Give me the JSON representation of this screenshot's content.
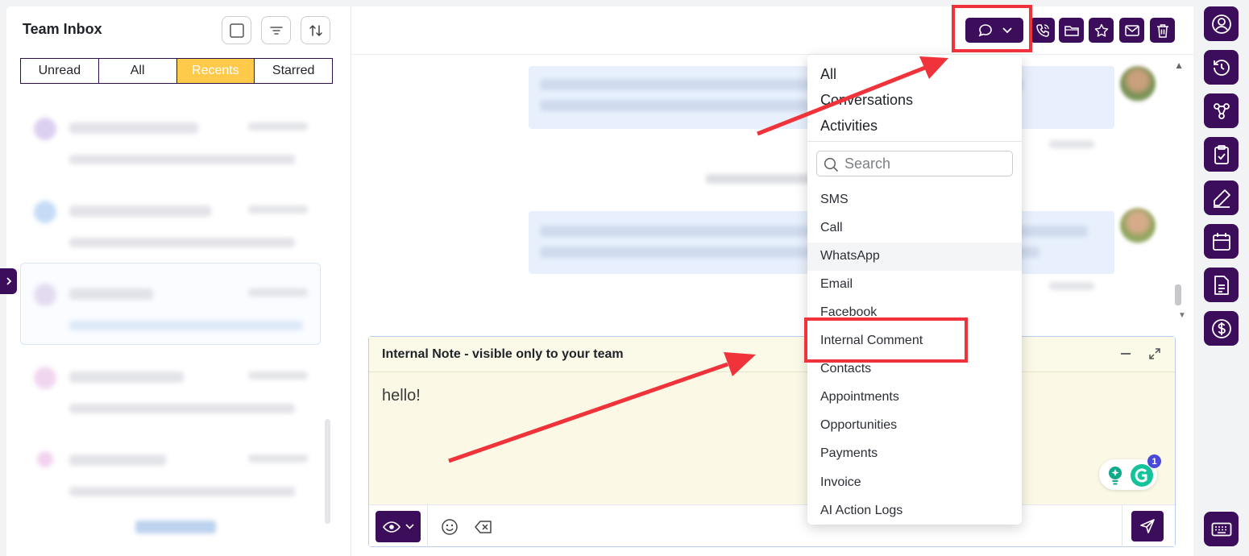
{
  "left_panel": {
    "title": "Team Inbox",
    "tabs": [
      {
        "label": "Unread",
        "active": false
      },
      {
        "label": "All",
        "active": false
      },
      {
        "label": "Recents",
        "active": true
      },
      {
        "label": "Starred",
        "active": false
      }
    ],
    "header_icons": [
      "checkbox-icon",
      "filter-icon",
      "sort-icon"
    ]
  },
  "main": {
    "composer": {
      "title": "Internal Note - visible only to your team",
      "body_text": "hello!",
      "footer_icons": [
        "eye-icon",
        "emoji-icon",
        "clear-icon",
        "send-icon"
      ]
    },
    "header_icons": [
      "chat-channel-icon",
      "phone-icon",
      "folder-icon",
      "star-icon",
      "mail-icon",
      "trash-icon"
    ]
  },
  "dropdown": {
    "top_options": [
      "All",
      "Conversations",
      "Activities"
    ],
    "search_placeholder": "Search",
    "items": [
      "SMS",
      "Call",
      "WhatsApp",
      "Email",
      "Facebook",
      "Internal Comment",
      "Contacts",
      "Appointments",
      "Opportunities",
      "Payments",
      "Invoice",
      "AI Action Logs"
    ],
    "hovered_item": "WhatsApp",
    "highlighted_item": "Internal Comment"
  },
  "grammarly_badge": "1",
  "right_rail_icons": [
    "user-circle-icon",
    "history-icon",
    "workflow-icon",
    "clipboard-check-icon",
    "pen-icon",
    "calendar-icon",
    "document-icon",
    "dollar-icon",
    "keyboard-icon"
  ],
  "colors": {
    "brand_purple": "#3b0d5b",
    "active_tab": "#ffc94a",
    "annotation_red": "#f0333a",
    "note_bg": "#fbf9e6"
  }
}
